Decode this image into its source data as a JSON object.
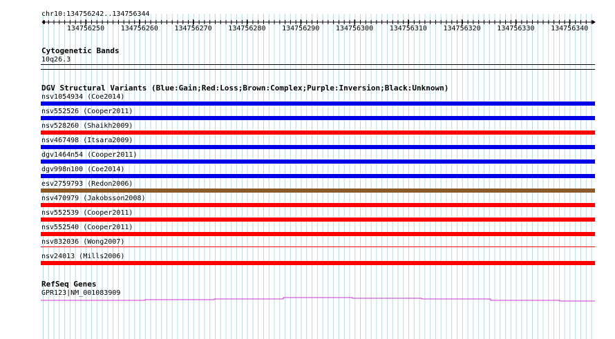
{
  "ruler": {
    "location": "chr10:134756242..134756344",
    "ticks": [
      "134756250",
      "134756260",
      "134756270",
      "134756280",
      "134756290",
      "134756300",
      "134756310",
      "134756320",
      "134756330",
      "134756340"
    ]
  },
  "tracks": {
    "cytoband": {
      "title": "Cytogenetic Bands",
      "band": "10q26.3"
    },
    "dgv": {
      "title": "DGV Structural Variants (Blue:Gain;Red:Loss;Brown:Complex;Purple:Inversion;Black:Unknown)",
      "colors": {
        "gain": "#0000e6",
        "loss": "#ff0000",
        "complex": "#8b5a2b",
        "inversion": "#800080",
        "unknown": "#000000"
      },
      "features": [
        {
          "label": "nsv1054934 (Coe2014)",
          "type": "gain"
        },
        {
          "label": "nsv552526 (Cooper2011)",
          "type": "gain"
        },
        {
          "label": "nsv528260 (Shaikh2009)",
          "type": "loss"
        },
        {
          "label": "nsv467498 (Itsara2009)",
          "type": "gain"
        },
        {
          "label": "dgv1464n54 (Cooper2011)",
          "type": "gain"
        },
        {
          "label": "dgv998n100 (Coe2014)",
          "type": "gain"
        },
        {
          "label": "esv2759793 (Redon2006)",
          "type": "complex"
        },
        {
          "label": "nsv470979 (Jakobsson2008)",
          "type": "loss"
        },
        {
          "label": "nsv552539 (Cooper2011)",
          "type": "loss"
        },
        {
          "label": "nsv552540 (Cooper2011)",
          "type": "loss"
        },
        {
          "label": "nsv832036 (Wong2007)",
          "type": "loss",
          "thin": true
        },
        {
          "label": "nsv24013 (Mills2006)",
          "type": "loss"
        }
      ]
    },
    "refseq": {
      "title": "RefSeq Genes",
      "gene_label": "GPR123|NM_001083909",
      "color": "#cc33cc"
    }
  }
}
